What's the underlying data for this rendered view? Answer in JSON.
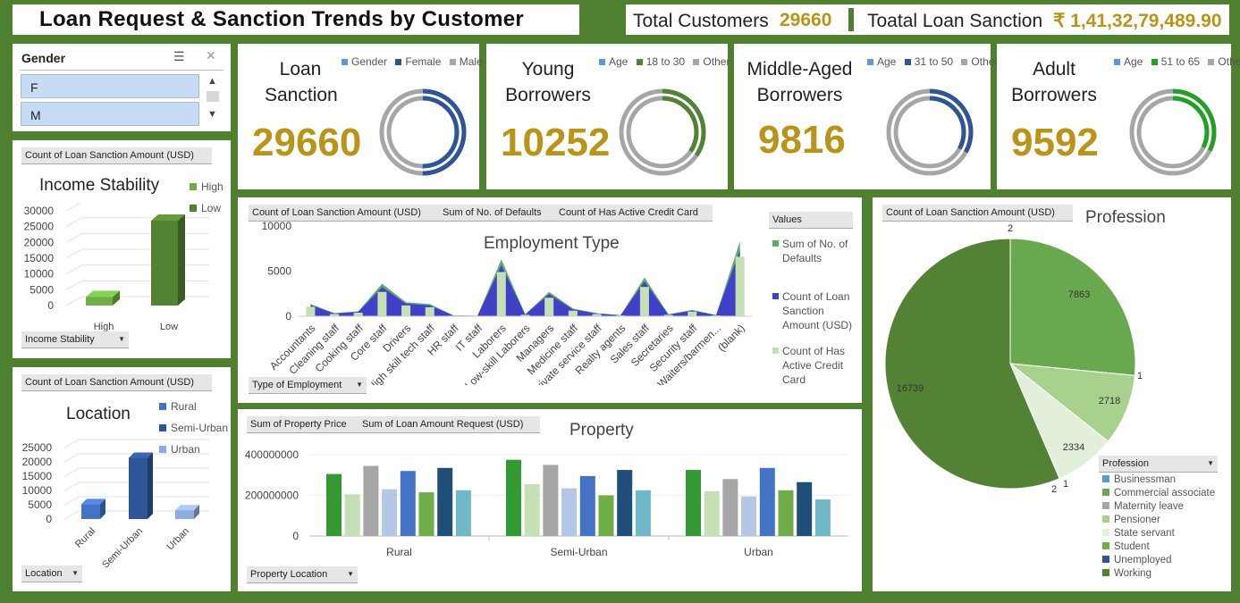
{
  "header": {
    "title": "Loan Request & Sanction Trends by Customer",
    "total_customers_label": "Total Customers",
    "total_customers_value": "29660",
    "total_sanction_label": "Toatal Loan Sanction",
    "total_sanction_value": "₹ 1,41,32,79,489.90"
  },
  "slicer": {
    "title": "Gender",
    "items": [
      "F",
      "M"
    ]
  },
  "cards": [
    {
      "title_line1": "Loan",
      "title_line2": "Sanction",
      "value": "29660",
      "legend": [
        "Gender",
        "Female",
        "Male"
      ],
      "fraction": 0.5,
      "color": "#2f5597"
    },
    {
      "title_line1": "Young",
      "title_line2": "Borrowers",
      "value": "10252",
      "legend": [
        "Age",
        "18 to 30",
        "Other"
      ],
      "fraction": 0.345,
      "color": "#548235"
    },
    {
      "title_line1": "Middle-Aged",
      "title_line2": "Borrowers",
      "value": "9816",
      "legend": [
        "Age",
        "31 to 50",
        "Other"
      ],
      "fraction": 0.33,
      "color": "#2f5597"
    },
    {
      "title_line1": "Adult",
      "title_line2": "Borrowers",
      "value": "9592",
      "legend": [
        "Age",
        "51 to 65",
        "Other"
      ],
      "fraction": 0.323,
      "color": "#22a022"
    }
  ],
  "legend_colors": {
    "key": "#5b9bd5",
    "other": "#a6a6a6"
  },
  "chart_data": [
    {
      "id": "income",
      "type": "bar",
      "title": "Income Stability",
      "field_tag": "Count of Loan Sanction Amount (USD)",
      "filter_tag": "Income Stability",
      "categories": [
        "High",
        "Low"
      ],
      "series": [
        {
          "name": "High",
          "values": [
            2700,
            0
          ]
        },
        {
          "name": "Low",
          "values": [
            0,
            26900
          ]
        }
      ],
      "legend": [
        "High",
        "Low"
      ],
      "colors": [
        "#70ad47",
        "#548235"
      ],
      "ylim": [
        0,
        30000
      ],
      "yticks": [
        "30000",
        "25000",
        "20000",
        "15000",
        "10000",
        "5000",
        "0"
      ]
    },
    {
      "id": "location",
      "type": "bar",
      "title": "Location",
      "field_tag": "Count of Loan Sanction Amount (USD)",
      "filter_tag": "Location",
      "categories": [
        "Rural",
        "Semi-Urban",
        "Urban"
      ],
      "values": [
        5200,
        21400,
        3100
      ],
      "legend": [
        "Rural",
        "Semi-Urban",
        "Urban"
      ],
      "colors": [
        "#4472c4",
        "#2f5597",
        "#8faadc"
      ],
      "ylim": [
        0,
        25000
      ],
      "yticks": [
        "25000",
        "20000",
        "15000",
        "10000",
        "5000",
        "0"
      ]
    },
    {
      "id": "employment",
      "type": "area",
      "title": "Employment Type",
      "field_tags": [
        "Count of Loan Sanction Amount (USD)",
        "Sum of No. of Defaults",
        "Count of Has Active Credit Card"
      ],
      "filter_tag": "Type of Employment",
      "legend_title": "Values",
      "categories": [
        "Accountants",
        "Cleaning staff",
        "Cooking staff",
        "Core staff",
        "Drivers",
        "High skill tech staff",
        "HR staff",
        "IT staff",
        "Laborers",
        "Low-skill Laborers",
        "Managers",
        "Medicine staff",
        "Private service staff",
        "Realty agents",
        "Sales staff",
        "Secretaries",
        "Security staff",
        "Waiters/barmen...",
        "(blank)"
      ],
      "series": [
        {
          "name": "Sum of No. of Defaults",
          "values": [
            1350,
            350,
            550,
            3600,
            1550,
            1350,
            90,
            60,
            6300,
            220,
            2700,
            850,
            350,
            120,
            4300,
            220,
            700,
            130,
            8300
          ],
          "color": "#5aab6c"
        },
        {
          "name": "Count of Loan Sanction Amount (USD)",
          "values": [
            1250,
            300,
            480,
            3200,
            1400,
            1200,
            80,
            50,
            5650,
            190,
            2450,
            750,
            300,
            100,
            3850,
            190,
            620,
            110,
            7300
          ],
          "color": "#4040c8"
        },
        {
          "name": "Count of Has Active Credit Card",
          "values": [
            1050,
            250,
            400,
            2700,
            1200,
            1000,
            70,
            40,
            4900,
            160,
            2050,
            620,
            250,
            90,
            3250,
            160,
            520,
            90,
            6600
          ],
          "color": "#c5e0b4"
        }
      ],
      "ylim": [
        0,
        10000
      ],
      "yticks": [
        "10000",
        "5000",
        "0"
      ]
    },
    {
      "id": "property",
      "type": "bar",
      "title": "Property",
      "field_tags": [
        "Sum of Property Price",
        "Sum of Loan Amount Request (USD)"
      ],
      "filter_tag": "Property Location",
      "categories": [
        "Rural",
        "Semi-Urban",
        "Urban"
      ],
      "groups": [
        [
          305000000,
          205000000,
          345000000,
          230000000,
          320000000,
          215000000,
          335000000,
          225000000
        ],
        [
          375000000,
          255000000,
          350000000,
          235000000,
          295000000,
          200000000,
          325000000,
          225000000
        ],
        [
          325000000,
          220000000,
          280000000,
          195000000,
          335000000,
          225000000,
          265000000,
          180000000
        ]
      ],
      "colors": [
        "#339933",
        "#c5e0b4",
        "#a6a6a6",
        "#b4c7e7",
        "#4472c4",
        "#70ad47",
        "#1f4e79",
        "#70b8c8"
      ],
      "ylim": [
        0,
        400000000
      ],
      "yticks": [
        "400000000",
        "200000000",
        "0"
      ]
    },
    {
      "id": "profession",
      "type": "pie",
      "title": "Profession",
      "field_tag": "Count of Loan Sanction Amount (USD)",
      "filter_tag": "Profession",
      "slices": [
        {
          "name": "Businessman",
          "value": 2,
          "label": "2",
          "color": "#5b9bd5"
        },
        {
          "name": "Commercial associate",
          "value": 7863,
          "label": "7863",
          "color": "#6aa84f"
        },
        {
          "name": "Maternity leave",
          "value": 1,
          "label": "1",
          "color": "#a6a6a6"
        },
        {
          "name": "Pensioner",
          "value": 2718,
          "label": "2718",
          "color": "#a9d18e"
        },
        {
          "name": "State servant",
          "value": 2334,
          "label": "2334",
          "color": "#e2efda"
        },
        {
          "name": "Student",
          "value": 1,
          "label": "1",
          "color": "#70ad47"
        },
        {
          "name": "Unemployed",
          "value": 2,
          "label": "2",
          "color": "#2f5597"
        },
        {
          "name": "Working",
          "value": 16739,
          "label": "16739",
          "color": "#548235"
        }
      ]
    }
  ]
}
